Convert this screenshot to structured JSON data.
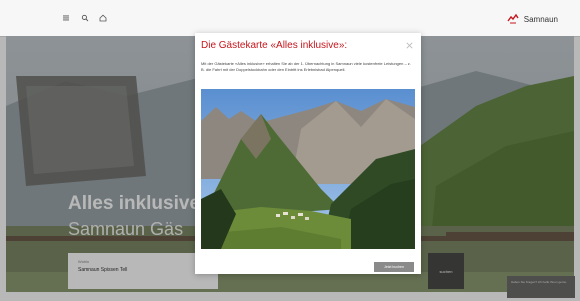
{
  "header": {
    "icons": [
      "menu-icon",
      "search-icon",
      "home-icon"
    ],
    "logo_text": "Samnaun"
  },
  "hero": {
    "title": "Alles inklusive",
    "subtitle": "Samnaun Gäs",
    "search": {
      "label": "Wohin",
      "value": "Samnaun Spissen Tell"
    },
    "search_button": "suchen",
    "chat_text": "Haben Sie Fragen? Ich helfe Ihnen gerne."
  },
  "modal": {
    "title": "Die Gästekarte «Alles inklusive»:",
    "text": "Mit der Gästekarte «Alles inklusive» erhalten Sie ab der 1. Übernachtung in Samnaun viele kostenfreie Leistungen – z. B. die Fahrt mit der Doppelstockbahn oder den Eintritt ins Erlebnisbad Alpenquell.",
    "button_label": "Jetzt buchen",
    "close_icon": "close-icon"
  },
  "colors": {
    "accent_red": "#c4161c",
    "button_gray": "#8a8a8a",
    "overlay": "rgba(0,0,0,0.28)"
  }
}
